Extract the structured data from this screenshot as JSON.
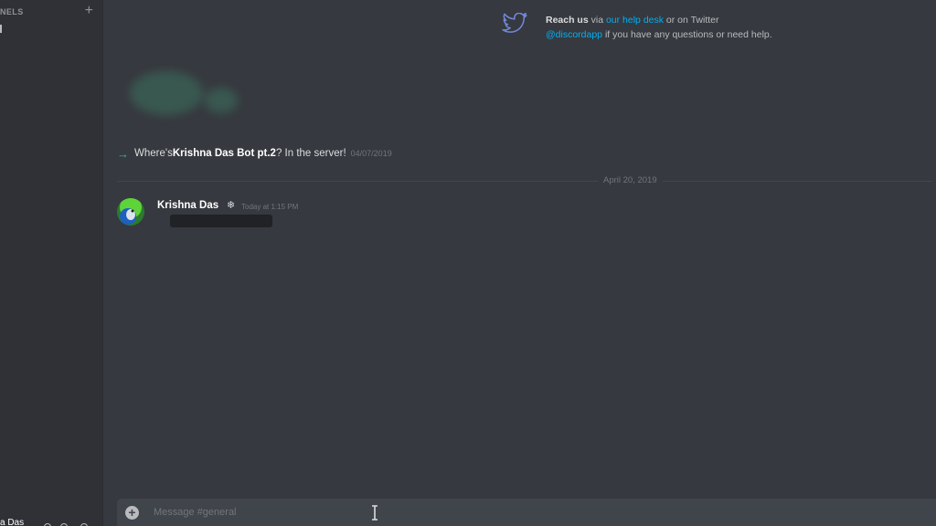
{
  "sidebar": {
    "header_label": "NELS",
    "add_label": "+",
    "user_name": "a Das"
  },
  "reach": {
    "line1_bold": "Reach us",
    "line1_mid1": " via ",
    "line1_link": "our help desk",
    "line1_mid2": " or on Twitter",
    "line2_link": "@discordapp",
    "line2_tail": " if you have any questions or need help.",
    "icon": "twitter-icon"
  },
  "join_message": {
    "arrow": "→",
    "prefix": "Where's ",
    "name": "Krishna Das Bot pt.2",
    "suffix": "? In the server!",
    "date": "04/07/2019"
  },
  "divider": {
    "label": "April 20, 2019"
  },
  "message": {
    "author": "Krishna Das",
    "badge": "❄",
    "time": "Today at 1:15 PM"
  },
  "composer": {
    "attach_label": "+",
    "placeholder": "Message #general"
  },
  "colors": {
    "background": "#36393f",
    "sidebar": "#2f3136",
    "link": "#00b0f4",
    "join_arrow": "#43b581"
  }
}
